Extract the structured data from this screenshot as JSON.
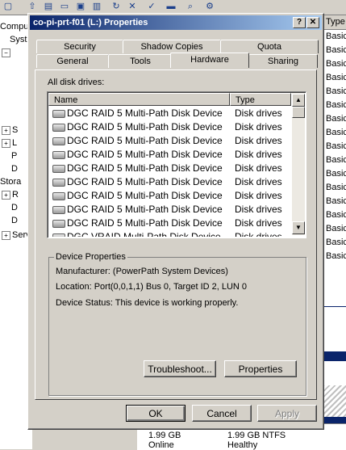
{
  "background": {
    "tree_items": [
      "Compute",
      "Syst",
      "S",
      "L",
      "P",
      "D",
      "Stora",
      "R",
      "D",
      "D",
      "Serv"
    ],
    "type_header": "Type",
    "type_cells": [
      "Basic",
      "Basic",
      "Basic",
      "Basic",
      "Basic",
      "Basic",
      "Basic",
      "Basic",
      "Basic",
      "Basic",
      "Basic",
      "Basic",
      "Basic",
      "Basic",
      "Basic",
      "Basic",
      "Basic"
    ],
    "bottom": {
      "size1": "1.99 GB",
      "status1": "Online",
      "size2": "1.99 GB NTFS",
      "status2": "Healthy"
    }
  },
  "dialog": {
    "title": "co-pi-prt-f01 (L:) Properties",
    "help_glyph": "?",
    "close_glyph": "✕",
    "tabs_back": [
      "Security",
      "Shadow Copies",
      "Quota"
    ],
    "tabs_front": [
      "General",
      "Tools",
      "Hardware",
      "Sharing"
    ],
    "active_tab": "Hardware",
    "all_disk_drives_label": "All disk drives:",
    "columns": [
      "Name",
      "Type"
    ],
    "rows": [
      {
        "name": "DGC RAID 5  Multi-Path Disk Device",
        "type": "Disk drives"
      },
      {
        "name": "DGC RAID 5  Multi-Path Disk Device",
        "type": "Disk drives"
      },
      {
        "name": "DGC RAID 5  Multi-Path Disk Device",
        "type": "Disk drives"
      },
      {
        "name": "DGC RAID 5  Multi-Path Disk Device",
        "type": "Disk drives"
      },
      {
        "name": "DGC RAID 5  Multi-Path Disk Device",
        "type": "Disk drives"
      },
      {
        "name": "DGC RAID 5  Multi-Path Disk Device",
        "type": "Disk drives"
      },
      {
        "name": "DGC RAID 5  Multi-Path Disk Device",
        "type": "Disk drives"
      },
      {
        "name": "DGC RAID 5  Multi-Path Disk Device",
        "type": "Disk drives"
      },
      {
        "name": "DGC RAID 5  Multi-Path Disk Device",
        "type": "Disk drives"
      },
      {
        "name": "DGC VRAID  Multi-Path Disk Device",
        "type": "Disk drives"
      }
    ],
    "device_properties": {
      "title": "Device Properties",
      "manufacturer": "Manufacturer: (PowerPath System Devices)",
      "location": "Location: Port(0,0,1,1) Bus 0, Target ID 2, LUN 0",
      "status": "Device Status: This device is working properly."
    },
    "troubleshoot_button": "Troubleshoot...",
    "properties_button": "Properties",
    "ok_button": "OK",
    "cancel_button": "Cancel",
    "apply_button": "Apply"
  }
}
